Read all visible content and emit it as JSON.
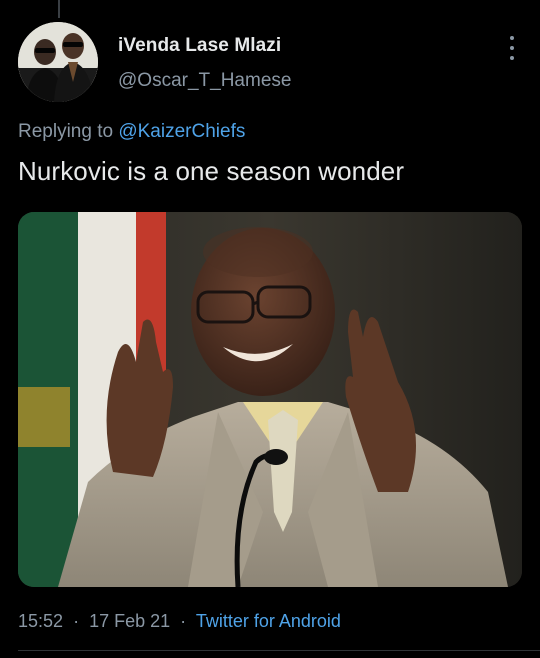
{
  "tweet": {
    "author": {
      "display_name": "iVenda Lase Mlazi",
      "handle": "@Oscar_T_Hamese",
      "avatar_icon": "profile-photo"
    },
    "reply_prefix": "Replying to",
    "reply_to": "@KaizerChiefs",
    "text": "Nurkovic is a one season wonder",
    "media": {
      "type": "photo"
    },
    "time": "15:52",
    "separator": "·",
    "date": "17 Feb 21",
    "source": "Twitter for Android",
    "more_icon": "more-vertical-icon"
  },
  "colors": {
    "background": "#000000",
    "text_primary": "#e7e9ea",
    "text_secondary": "#8b98a5",
    "link": "#4fa3e8"
  }
}
